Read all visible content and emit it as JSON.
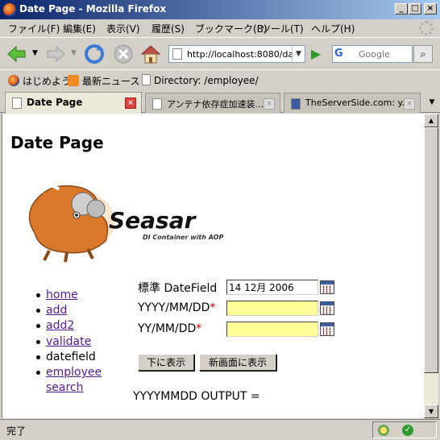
{
  "window": {
    "title": "Date Page - Mozilla Firefox",
    "minimize": "_",
    "maximize": "□",
    "close": "×"
  },
  "menubar": {
    "items": [
      "ファイル(F)",
      "編集(E)",
      "表示(V)",
      "履歴(S)",
      "ブックマーク(B)",
      "ツール(T)",
      "ヘルプ(H)"
    ]
  },
  "navbar": {
    "url": "http://localhost:8080/da",
    "search_engine": "G",
    "search_placeholder": "Google"
  },
  "bookmarks": {
    "items": [
      "はじめよう",
      "最新ニュース",
      "Directory: /employee/"
    ]
  },
  "tabs": [
    {
      "label": "Date Page",
      "active": true
    },
    {
      "label": "アンテナ依存症加速装...",
      "active": false
    },
    {
      "label": "TheServerSide.com: y...",
      "active": false
    }
  ],
  "page": {
    "title": "Date Page",
    "logo_text": "Seasar",
    "logo_tagline": "DI Container with AOP",
    "nav": [
      {
        "label": "home",
        "link": true
      },
      {
        "label": "add",
        "link": true
      },
      {
        "label": "add2",
        "link": true
      },
      {
        "label": "validate",
        "link": true
      },
      {
        "label": "datefield",
        "link": false
      },
      {
        "label": "employee",
        "link": true
      },
      {
        "label": "search",
        "link": true
      }
    ],
    "form": {
      "standard_label": "標準 DateField",
      "standard_value": "14 12月 2006",
      "yyyy_label": "YYYY/MM/DD",
      "yyyy_value": "",
      "yy_label": "YY/MM/DD",
      "yy_value": "",
      "required_mark": "*",
      "button_below": "下に表示",
      "button_newwin": "新画面に表示"
    },
    "output_label": "YYYYMMDD OUTPUT ="
  },
  "status": {
    "text": "完了"
  },
  "colors": {
    "link": "#551a8b",
    "required": "#cc0000",
    "highlight_field": "#ffff99",
    "titlebar_start": "#0a246a",
    "titlebar_end": "#a6caf0"
  }
}
